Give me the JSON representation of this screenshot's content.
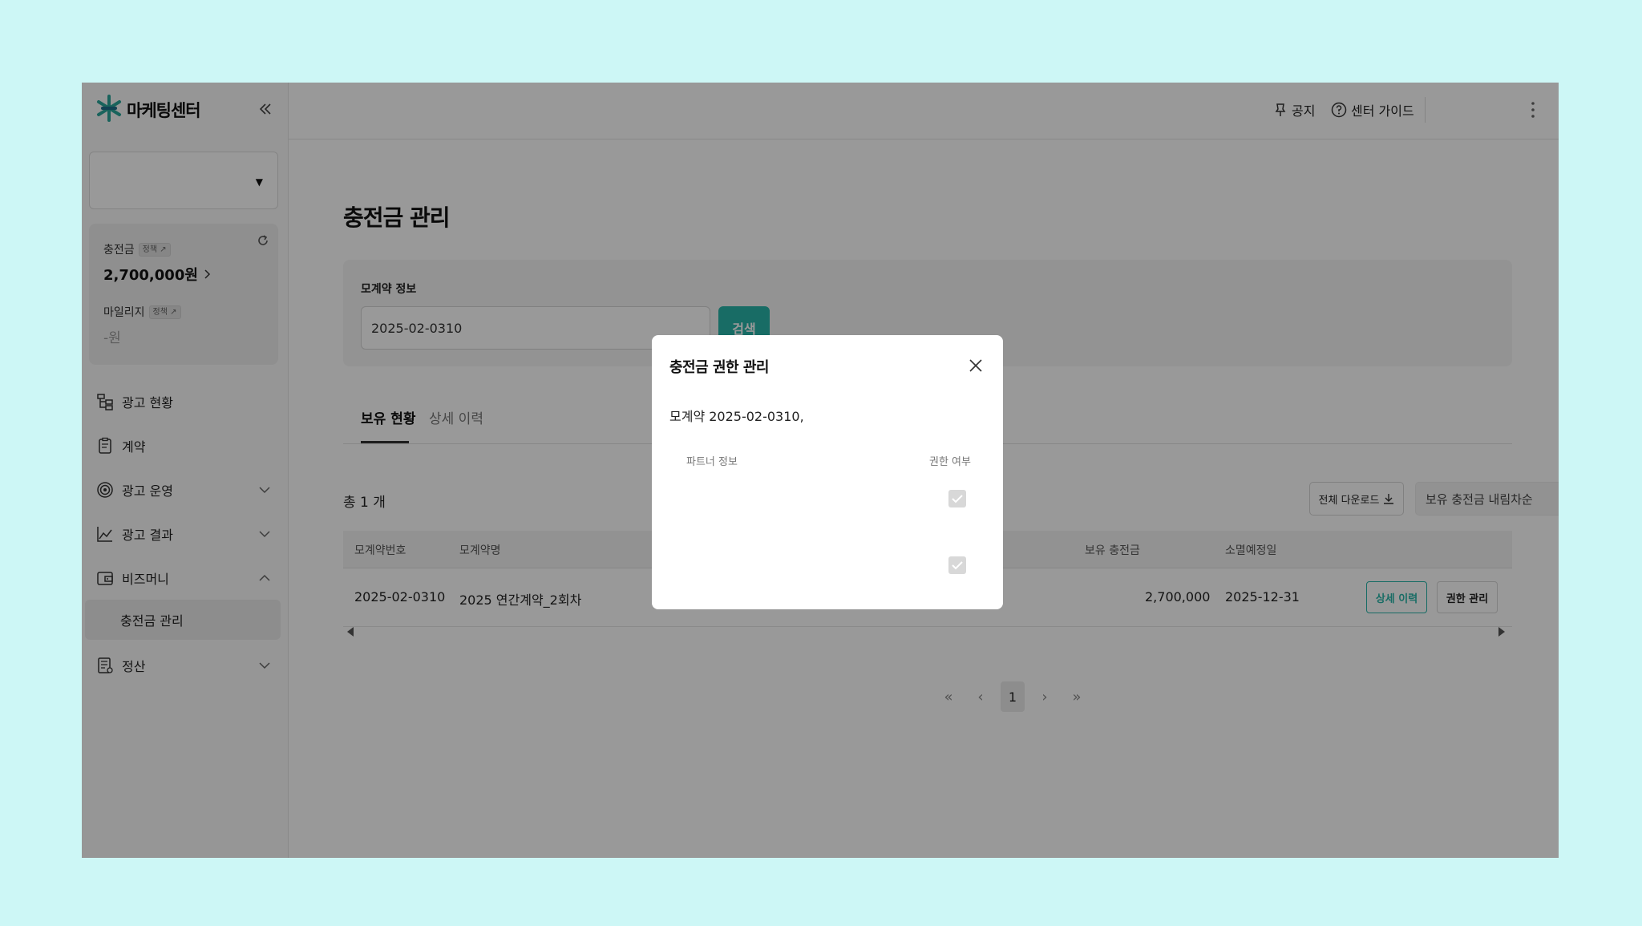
{
  "brand": {
    "name": "마케팅센터",
    "icon": "asterisk-logo-icon"
  },
  "sidebar": {
    "account_select_value": "",
    "balance": {
      "charge_label": "충전금",
      "charge_badge": "정책 ↗",
      "charge_value": "2,700,000원",
      "mileage_label": "마일리지",
      "mileage_badge": "정책 ↗",
      "mileage_value": "-원"
    },
    "nav": [
      {
        "label": "광고 현황",
        "icon": "hierarchy-icon"
      },
      {
        "label": "계약",
        "icon": "clipboard-icon"
      },
      {
        "label": "광고 운영",
        "icon": "target-icon"
      },
      {
        "label": "광고 결과",
        "icon": "line-chart-icon"
      },
      {
        "label": "비즈머니",
        "icon": "wallet-icon"
      },
      {
        "label": "충전금 관리"
      },
      {
        "label": "정산",
        "icon": "receipt-icon"
      }
    ]
  },
  "header": {
    "notice_label": "공지",
    "guide_label": "센터 가이드"
  },
  "main": {
    "title": "충전금 관리",
    "search": {
      "label": "모계약 정보",
      "value": "2025-02-0310",
      "button": "검색"
    },
    "tabs": [
      "보유 현황",
      "상세 이력"
    ],
    "count": "총 1 개",
    "download_label": "전체 다운로드",
    "sort_label": "보유 충전금 내림차순",
    "table": {
      "columns": [
        "모계약번호",
        "모계약명",
        "보유 충전금",
        "소멸예정일"
      ],
      "rows": [
        {
          "contract_no": "2025-02-0310",
          "contract_name": "2025 연간계약_2회차",
          "balance": "2,700,000",
          "expiry": "2025-12-31",
          "detail_btn": "상세 이력",
          "perm_btn": "권한 관리"
        }
      ]
    },
    "pagination": {
      "first": "«",
      "prev": "‹",
      "current": "1",
      "next": "›",
      "last": "»"
    }
  },
  "modal": {
    "title": "충전금 권한 관리",
    "description": "모계약 2025-02-0310,",
    "col_partner": "파트너 정보",
    "col_permission": "권한 여부",
    "rows": [
      {
        "checked": true
      },
      {
        "checked": true
      }
    ]
  },
  "colors": {
    "accent": "#28b5a8",
    "page_bg": "#cdf7f6"
  }
}
